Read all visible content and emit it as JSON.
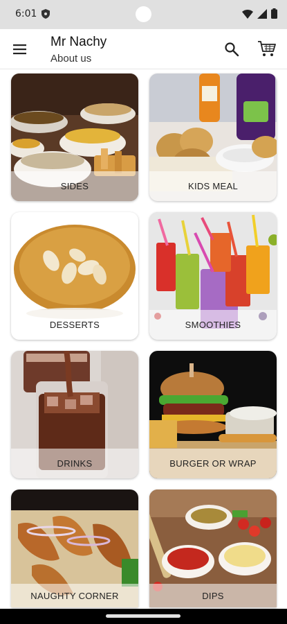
{
  "status": {
    "time": "6:01"
  },
  "header": {
    "title": "Mr Nachy",
    "subtitle": "About us"
  },
  "categories": [
    {
      "label": "SIDES"
    },
    {
      "label": "KIDS MEAL"
    },
    {
      "label": "DESSERTS"
    },
    {
      "label": "SMOOTHIES"
    },
    {
      "label": "DRINKS"
    },
    {
      "label": "BURGER OR WRAP"
    },
    {
      "label": "NAUGHTY CORNER"
    },
    {
      "label": "DIPS"
    }
  ]
}
